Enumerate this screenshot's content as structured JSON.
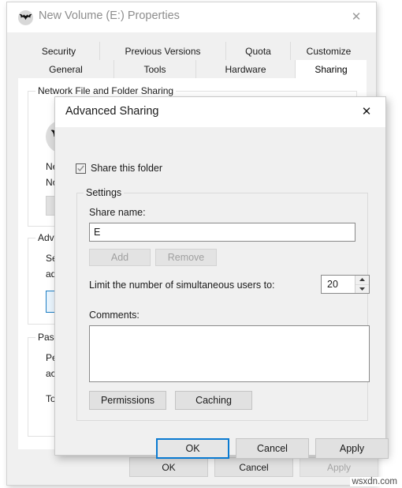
{
  "parent_window": {
    "title": "New Volume (E:) Properties",
    "icon": "bat-drive-icon",
    "close_label": "✕",
    "tabs_row1": [
      {
        "label": "Security",
        "active": false
      },
      {
        "label": "Previous Versions",
        "active": false
      },
      {
        "label": "Quota",
        "active": false
      },
      {
        "label": "Customize",
        "active": false
      }
    ],
    "tabs_row2": [
      {
        "label": "General",
        "active": false
      },
      {
        "label": "Tools",
        "active": false
      },
      {
        "label": "Hardware",
        "active": false
      },
      {
        "label": "Sharing",
        "active": true
      }
    ],
    "network_group_label": "Network File and Folder Sharing",
    "network_line1": "Netw",
    "network_line2": "Not S",
    "advanced_group_label": "Adva",
    "advanced_line1": "Set c",
    "advanced_line2": "adva",
    "password_group_label": "Passw",
    "password_line1": "Peop",
    "password_line2": "acce",
    "password_line3": "To c",
    "buttons": {
      "ok": "OK",
      "cancel": "Cancel",
      "apply": "Apply"
    }
  },
  "advanced_dialog": {
    "title": "Advanced Sharing",
    "close_label": "✕",
    "share_checkbox": {
      "label": "Share this folder",
      "checked": true
    },
    "settings_group_label": "Settings",
    "share_name_label": "Share name:",
    "share_name_value": "E",
    "share_name_placeholder": "",
    "add_button": "Add",
    "remove_button": "Remove",
    "limit_label": "Limit the number of simultaneous users to:",
    "limit_value": "20",
    "comments_label": "Comments:",
    "comments_value": "",
    "comments_placeholder": "",
    "permissions_button": "Permissions",
    "caching_button": "Caching",
    "footer": {
      "ok": "OK",
      "cancel": "Cancel",
      "apply": "Apply"
    }
  },
  "watermark": "wsxdn.com",
  "colors": {
    "accent": "#0a7ad1",
    "window_bg": "#f0f0f0",
    "content_bg": "#ffffff"
  }
}
